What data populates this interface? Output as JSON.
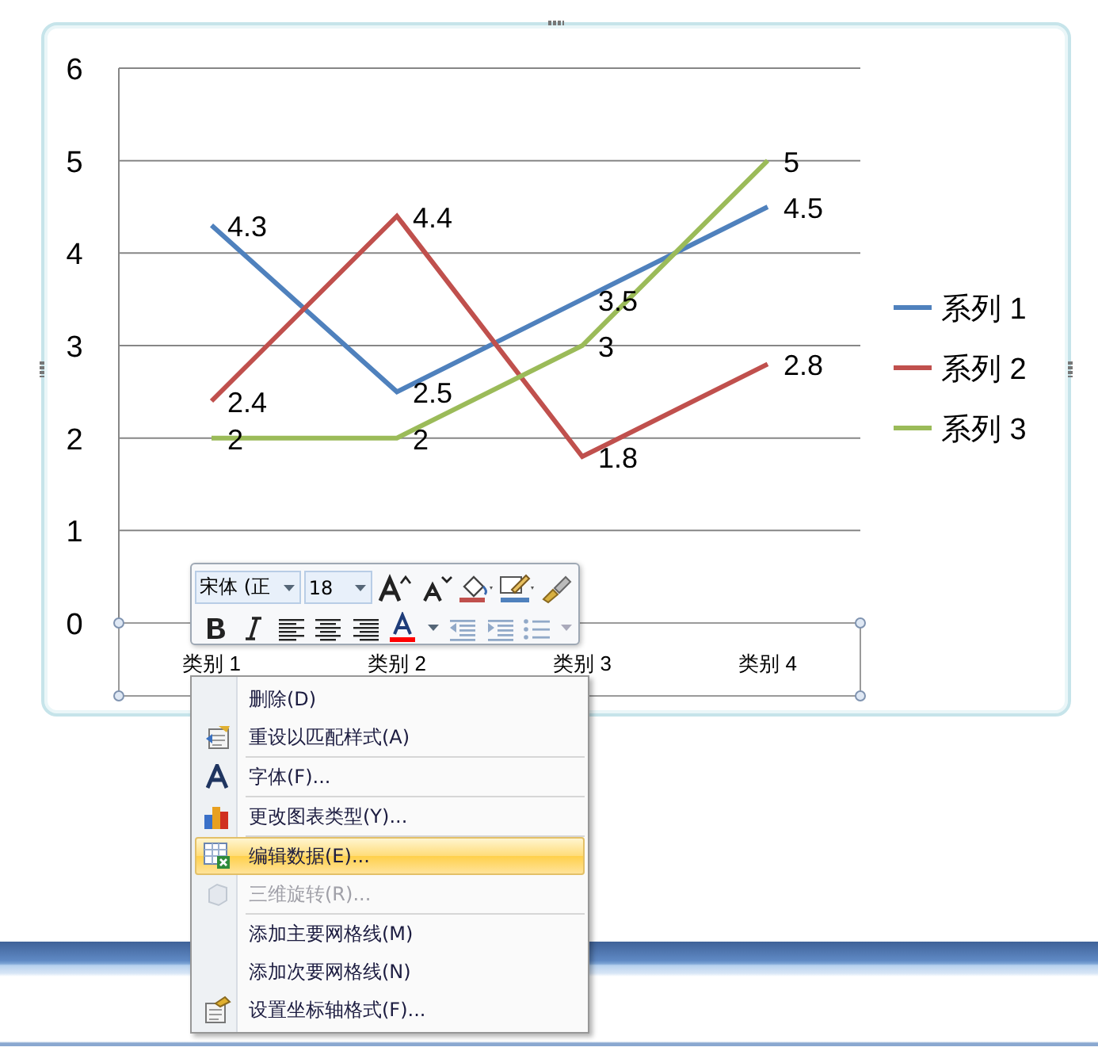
{
  "chart": {
    "chart_data": {
      "type": "line",
      "categories": [
        "类别 1",
        "类别 2",
        "类别 3",
        "类别 4"
      ],
      "series": [
        {
          "name": "系列 1",
          "color": "#4f81bd",
          "values": [
            4.3,
            2.5,
            3.5,
            4.5
          ]
        },
        {
          "name": "系列 2",
          "color": "#c0504d",
          "values": [
            2.4,
            4.4,
            1.8,
            2.8
          ]
        },
        {
          "name": "系列 3",
          "color": "#9bbb59",
          "values": [
            2,
            2,
            3,
            5
          ]
        }
      ],
      "ylim": [
        0,
        6
      ],
      "yticks": [
        0,
        1,
        2,
        3,
        4,
        5,
        6
      ],
      "data_labels": true,
      "grid": true,
      "legend": "right"
    }
  },
  "mini_toolbar": {
    "font": "宋体 (正",
    "size": "18",
    "buttons": [
      {
        "kind": "grow",
        "disabled": false
      },
      {
        "kind": "shrink",
        "disabled": false
      },
      {
        "kind": "fill",
        "disabled": false
      },
      {
        "kind": "outline",
        "disabled": false
      },
      {
        "kind": "painter",
        "disabled": false
      },
      {
        "kind": "bold",
        "disabled": false
      },
      {
        "kind": "italic",
        "disabled": false
      },
      {
        "kind": "left",
        "disabled": false
      },
      {
        "kind": "center",
        "disabled": false
      },
      {
        "kind": "right",
        "disabled": false
      },
      {
        "kind": "fontcolor",
        "disabled": false
      },
      {
        "kind": "outdent",
        "disabled": true
      },
      {
        "kind": "indent",
        "disabled": true
      },
      {
        "kind": "bullets",
        "disabled": true
      }
    ]
  },
  "context_menu": [
    {
      "kind": "item",
      "label": "删除(D)",
      "selected": false,
      "disabled": false
    },
    {
      "kind": "item",
      "label": "重设以匹配样式(A)",
      "selected": false,
      "disabled": false
    },
    {
      "kind": "separator"
    },
    {
      "kind": "item",
      "label": "字体(F)...",
      "selected": false,
      "disabled": false
    },
    {
      "kind": "separator"
    },
    {
      "kind": "item",
      "label": "更改图表类型(Y)...",
      "selected": false,
      "disabled": false
    },
    {
      "kind": "separator"
    },
    {
      "kind": "item",
      "label": "编辑数据(E)...",
      "selected": true,
      "disabled": false
    },
    {
      "kind": "item",
      "label": "三维旋转(R)...",
      "selected": false,
      "disabled": true
    },
    {
      "kind": "separator"
    },
    {
      "kind": "item",
      "label": "添加主要网格线(M)",
      "selected": false,
      "disabled": false
    },
    {
      "kind": "item",
      "label": "添加次要网格线(N)",
      "selected": false,
      "disabled": false
    },
    {
      "kind": "item",
      "label": "设置坐标轴格式(F)...",
      "selected": false,
      "disabled": false
    }
  ]
}
